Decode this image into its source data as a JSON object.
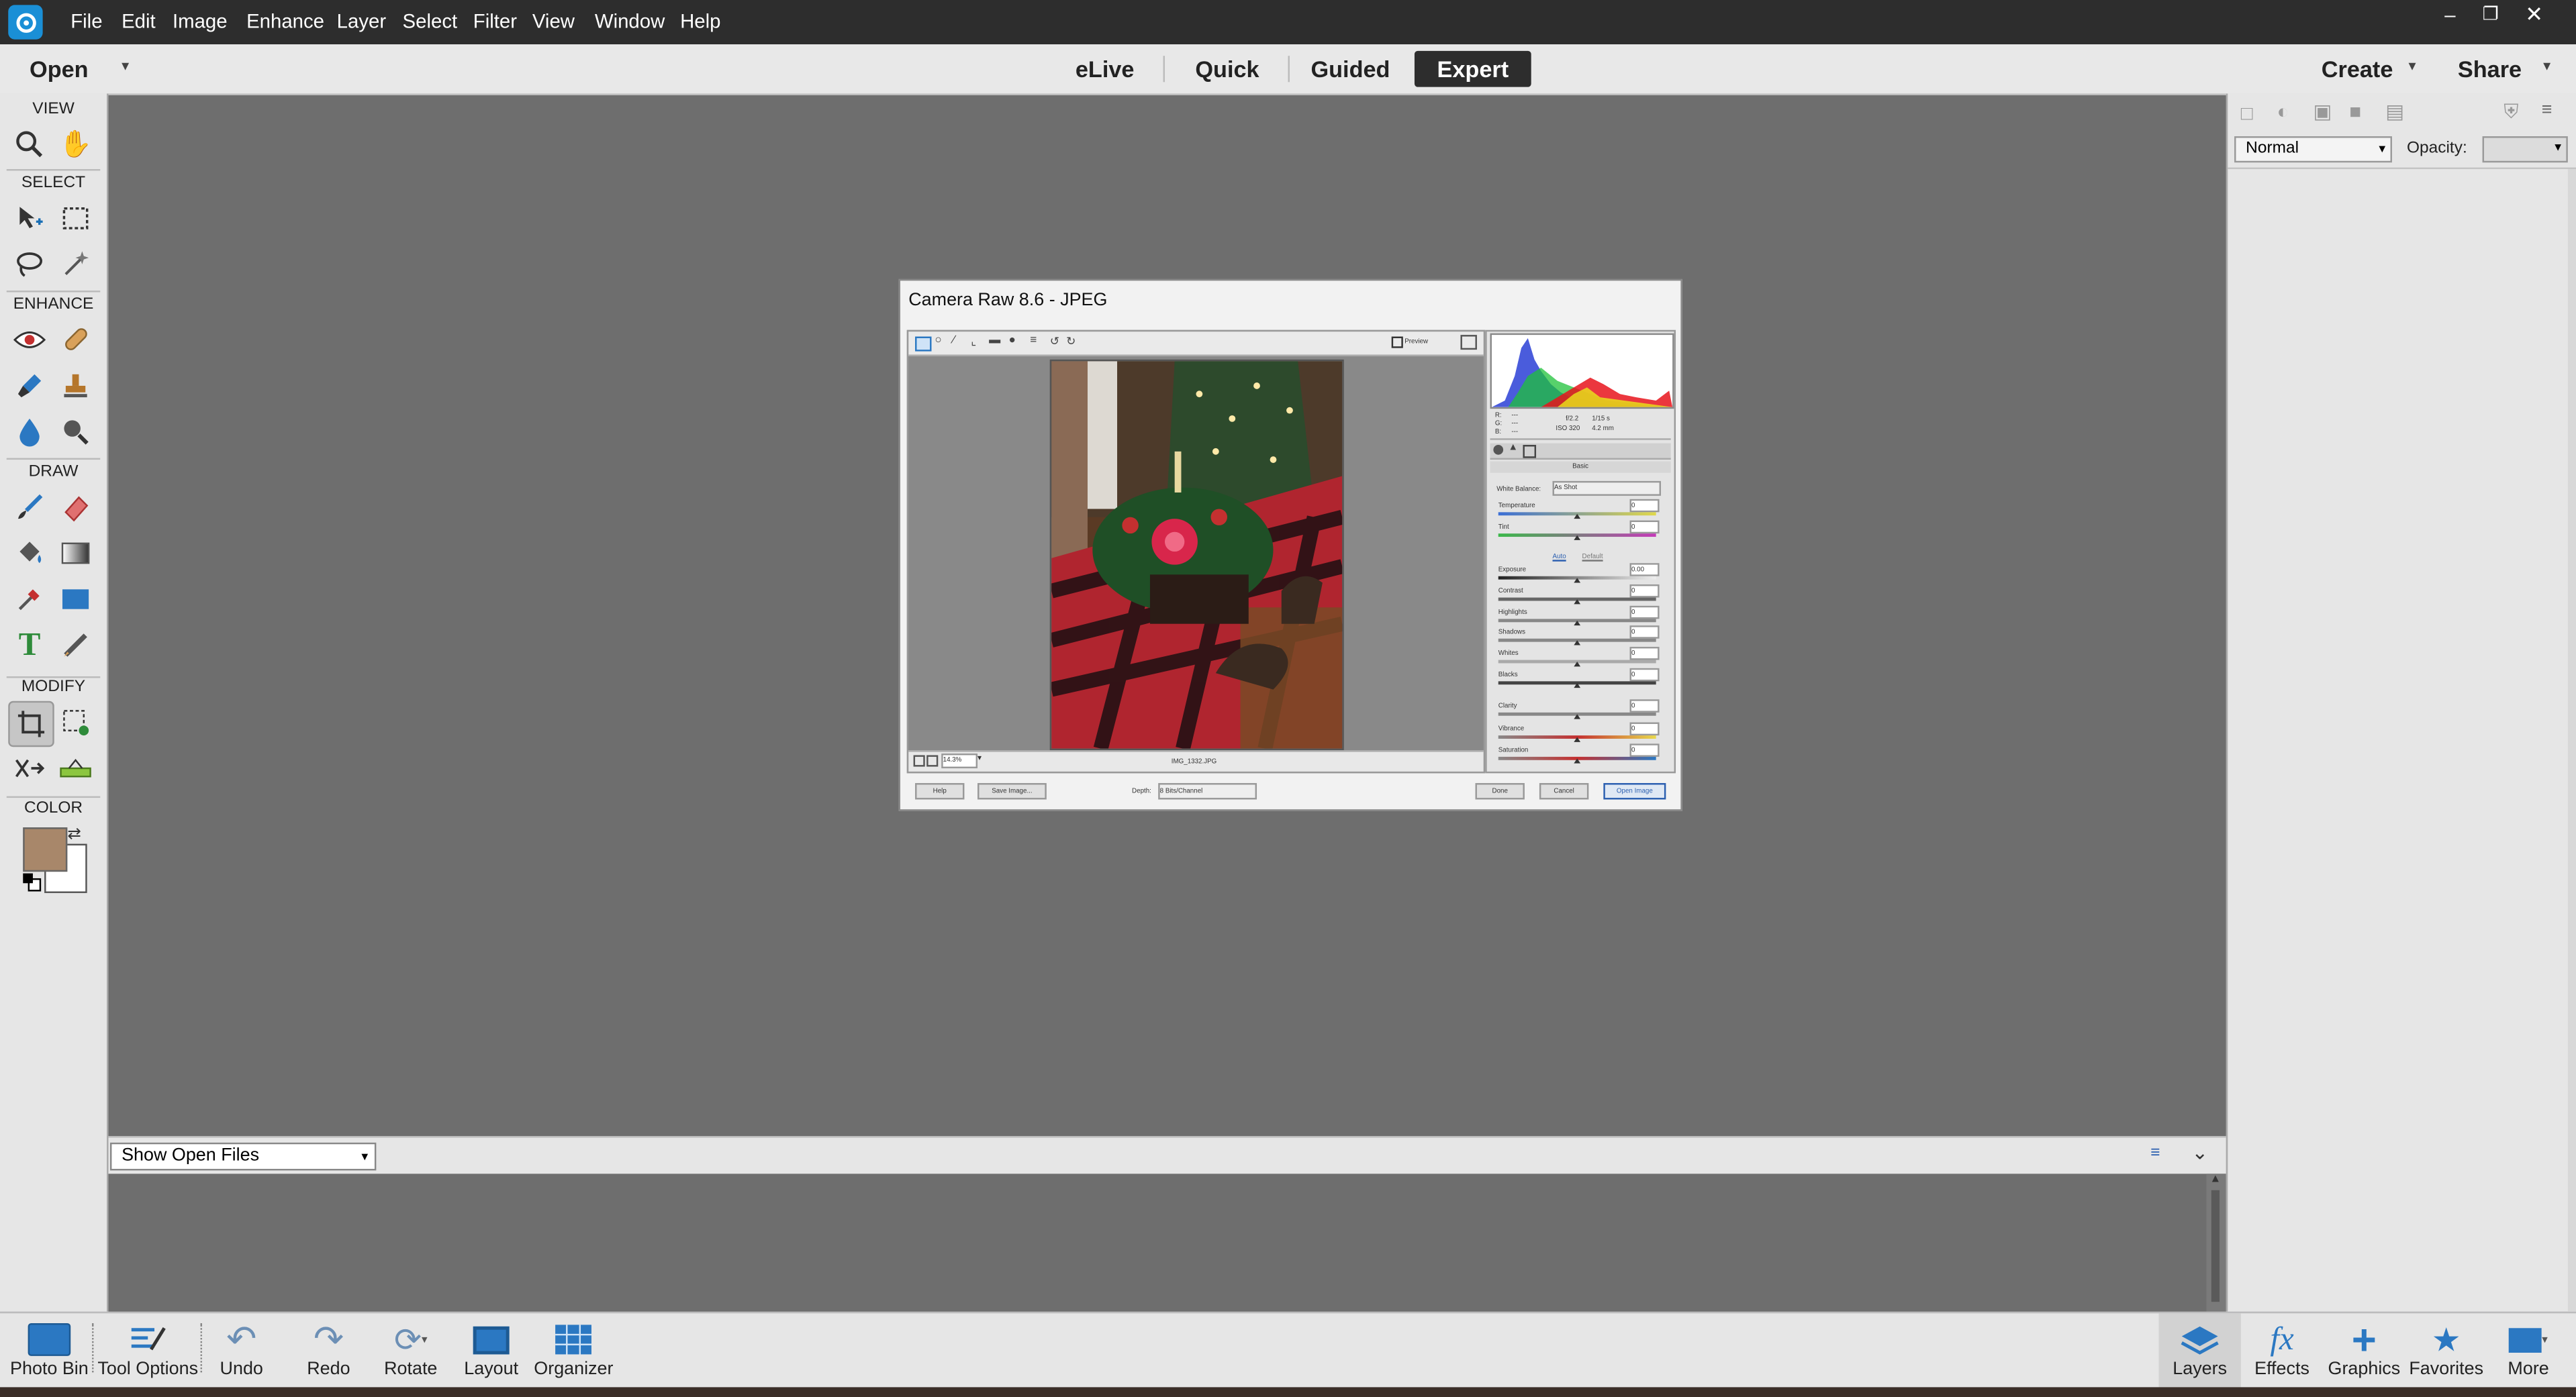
{
  "menu": [
    "File",
    "Edit",
    "Image",
    "Enhance",
    "Layer",
    "Select",
    "Filter",
    "View",
    "Window",
    "Help"
  ],
  "modebar": {
    "open_label": "Open",
    "tabs": [
      "eLive",
      "Quick",
      "Guided",
      "Expert"
    ],
    "active_tab": "Expert",
    "create_label": "Create",
    "share_label": "Share"
  },
  "toolbox": {
    "sections": {
      "view": "VIEW",
      "select": "SELECT",
      "enhance": "ENHANCE",
      "draw": "DRAW",
      "modify": "MODIFY",
      "color": "COLOR"
    },
    "foreground_color": "#a8876a",
    "background_color": "#ffffff"
  },
  "layers_panel": {
    "blend_mode": "Normal",
    "opacity_label": "Opacity:"
  },
  "photo_bin": {
    "dropdown": "Show Open Files"
  },
  "bottom_left": [
    "Photo Bin",
    "Tool Options",
    "Undo",
    "Redo",
    "Rotate",
    "Layout",
    "Organizer"
  ],
  "bottom_right": [
    "Layers",
    "Effects",
    "Graphics",
    "Favorites",
    "More"
  ],
  "camera_raw": {
    "title": "Camera Raw 8.6  -  JPEG",
    "preview_label": "Preview",
    "filename": "IMG_1332.JPG",
    "zoom": "14.3%",
    "readout": {
      "r": "R:",
      "g": "G:",
      "b": "B:",
      "dash": "---",
      "aperture": "f/2.2",
      "shutter": "1/15 s",
      "iso": "ISO 320",
      "focal": "4.2 mm"
    },
    "panel_title": "Basic",
    "white_balance_label": "White Balance:",
    "white_balance_value": "As Shot",
    "auto_label": "Auto",
    "default_label": "Default",
    "sliders_wb": [
      {
        "label": "Temperature",
        "value": "0"
      },
      {
        "label": "Tint",
        "value": "0"
      }
    ],
    "sliders_tone": [
      {
        "label": "Exposure",
        "value": "0.00"
      },
      {
        "label": "Contrast",
        "value": "0"
      },
      {
        "label": "Highlights",
        "value": "0"
      },
      {
        "label": "Shadows",
        "value": "0"
      },
      {
        "label": "Whites",
        "value": "0"
      },
      {
        "label": "Blacks",
        "value": "0"
      }
    ],
    "sliders_presence": [
      {
        "label": "Clarity",
        "value": "0"
      },
      {
        "label": "Vibrance",
        "value": "0"
      },
      {
        "label": "Saturation",
        "value": "0"
      }
    ],
    "buttons": {
      "help": "Help",
      "save": "Save Image...",
      "done": "Done",
      "cancel": "Cancel",
      "open": "Open Image"
    },
    "depth_label": "Depth:",
    "depth_value": "8 Bits/Channel"
  },
  "colors": {
    "accent": "#1a6fb5",
    "menubar": "#2d2d2d",
    "workspace": "#6e6e6e"
  }
}
